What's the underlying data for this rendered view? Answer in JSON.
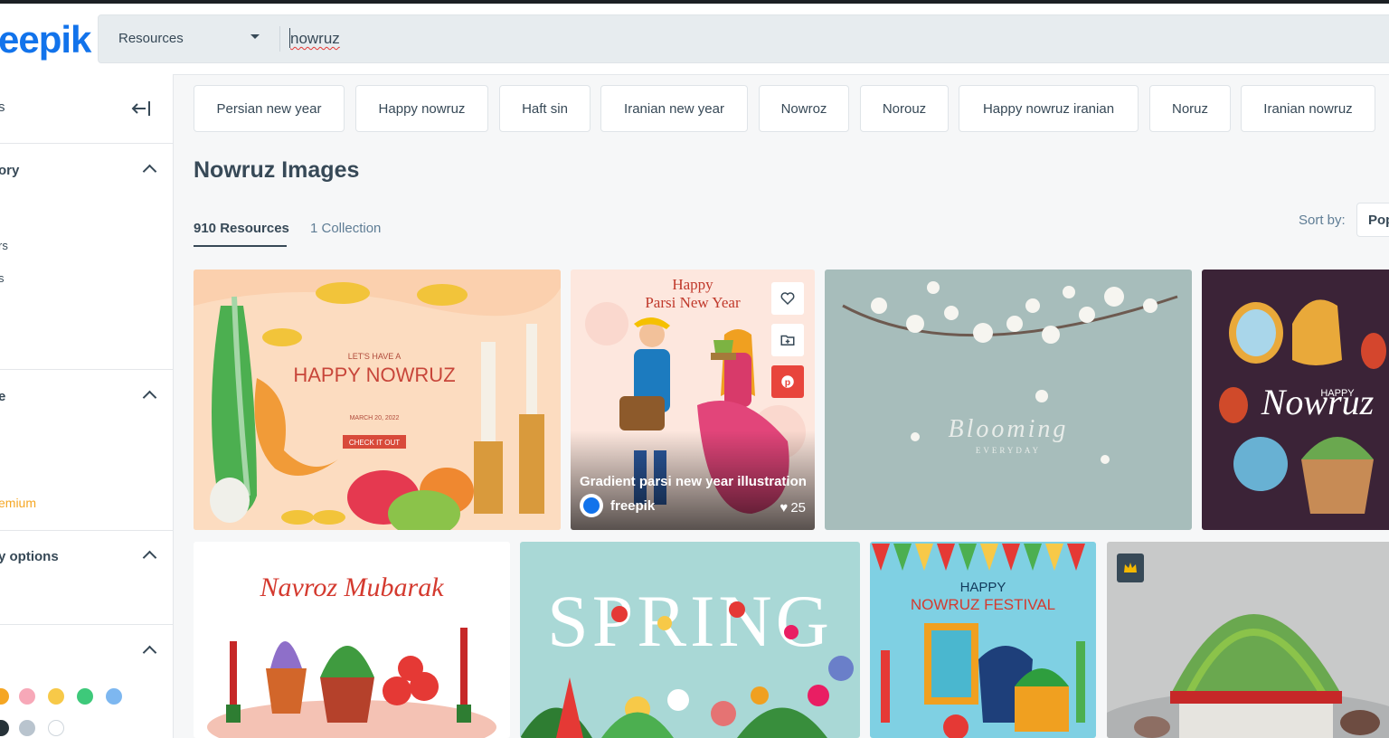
{
  "header": {
    "logo": "eepik",
    "resource_type": "Resources",
    "search_query": "nowruz"
  },
  "sidebar": {
    "filters_label": "s",
    "section_category": "ory",
    "category_items": [
      "rs",
      "s"
    ],
    "section_license": "e",
    "premium_label": "emium",
    "section_ai": "y options",
    "colors": [
      "#f5a623",
      "#f7a8b8",
      "#f7c948",
      "#3ec97a",
      "#7db7f0",
      "#263238",
      "#b9c4ce",
      "#ffffff"
    ]
  },
  "tags": [
    "Persian new year",
    "Happy nowruz",
    "Haft sin",
    "Iranian new year",
    "Nowroz",
    "Norouz",
    "Happy nowruz iranian",
    "Noruz",
    "Iranian nowruz"
  ],
  "main": {
    "title": "Nowruz Images",
    "tab_resources": "910 Resources",
    "tab_collections": "1 Collection",
    "sort_label": "Sort by:",
    "sort_value": "Pop"
  },
  "cards": {
    "c1": {
      "heading_small": "LET'S HAVE A",
      "heading": "HAPPY NOWRUZ",
      "date": "MARCH 20, 2022",
      "button": "CHECK IT OUT"
    },
    "c2": {
      "art_title1": "Happy",
      "art_title2": "Parsi New Year",
      "caption": "Gradient parsi new year illustration",
      "author": "freepik",
      "likes": "25"
    },
    "c3": {
      "art_title": "Blooming",
      "art_sub": "EVERYDAY"
    },
    "c4": {
      "art_small": "HAPPY",
      "art_title": "Nowruz"
    },
    "c5": {
      "art_title": "Navroz Mubarak"
    },
    "c6": {
      "art_title": "SPRING"
    },
    "c7": {
      "art_small": "HAPPY",
      "art_title": "NOWRUZ FESTIVAL"
    }
  },
  "colors": {
    "brand": "#1273eb",
    "text": "#374957",
    "premium": "#f5a623",
    "pinterest": "#e8453c"
  }
}
